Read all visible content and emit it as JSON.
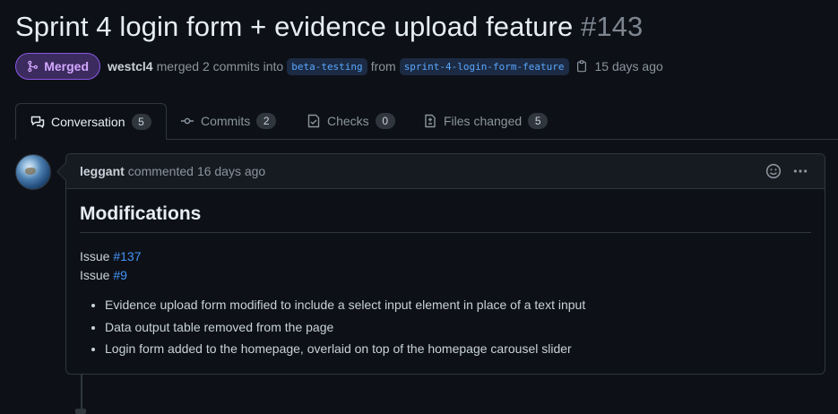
{
  "pr": {
    "title": "Sprint 4 login form + evidence upload feature",
    "number": "#143"
  },
  "meta": {
    "status": "Merged",
    "author": "westcl4",
    "merged_text": "merged 2 commits into",
    "base_branch": "beta-testing",
    "from_text": "from",
    "head_branch": "sprint-4-login-form-feature",
    "time": "15 days ago"
  },
  "tabs": [
    {
      "label": "Conversation",
      "count": "5",
      "icon": "comment-discussion-icon"
    },
    {
      "label": "Commits",
      "count": "2",
      "icon": "git-commit-icon"
    },
    {
      "label": "Checks",
      "count": "0",
      "icon": "checklist-icon"
    },
    {
      "label": "Files changed",
      "count": "5",
      "icon": "file-diff-icon"
    }
  ],
  "comment": {
    "user": "leggant",
    "action": "commented",
    "date": "16 days ago",
    "heading": "Modifications",
    "issues": [
      {
        "prefix": "Issue",
        "ref": "#137"
      },
      {
        "prefix": "Issue",
        "ref": "#9"
      }
    ],
    "bullets": [
      "Evidence upload form modified to include a select input element in place of a text input",
      "Data output table removed from the page",
      "Login form added to the homepage, overlaid on top of the homepage carousel slider"
    ]
  },
  "colors": {
    "background": "#0d1117",
    "merged_purple": "#8957e5",
    "link_blue": "#4493f8"
  }
}
